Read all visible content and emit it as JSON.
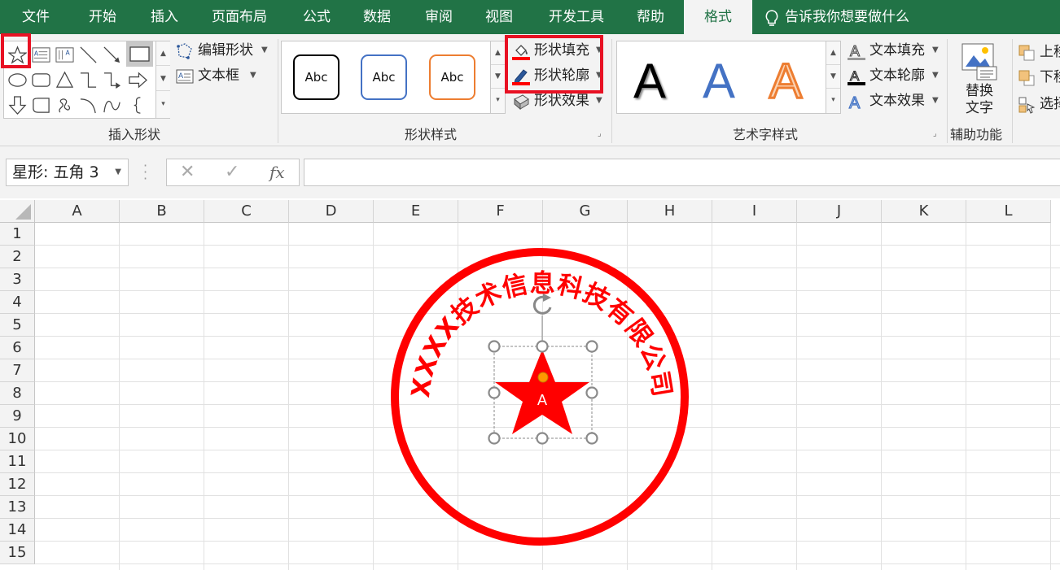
{
  "tabs": [
    {
      "label": "文件",
      "active": false
    },
    {
      "label": "开始",
      "active": false
    },
    {
      "label": "插入",
      "active": false
    },
    {
      "label": "页面布局",
      "active": false
    },
    {
      "label": "公式",
      "active": false
    },
    {
      "label": "数据",
      "active": false
    },
    {
      "label": "审阅",
      "active": false
    },
    {
      "label": "视图",
      "active": false
    },
    {
      "label": "开发工具",
      "active": false
    },
    {
      "label": "帮助",
      "active": false
    },
    {
      "label": "格式",
      "active": true
    }
  ],
  "tell_me": "告诉我你想要做什么",
  "ribbon": {
    "insert_shapes": {
      "label": "插入形状",
      "edit_shape": "编辑形状",
      "text_box": "文本框"
    },
    "shape_styles": {
      "label": "形状样式",
      "presets": [
        "Abc",
        "Abc",
        "Abc"
      ],
      "shape_fill": "形状填充",
      "shape_outline": "形状轮廓",
      "shape_effects": "形状效果"
    },
    "wordart_styles": {
      "label": "艺术字样式",
      "letters": [
        "A",
        "A",
        "A"
      ],
      "text_fill": "文本填充",
      "text_outline": "文本轮廓",
      "text_effects": "文本效果"
    },
    "accessibility": {
      "label": "辅助功能",
      "alt_text_line1": "替换",
      "alt_text_line2": "文字"
    },
    "arrange": {
      "bring_forward": "上移",
      "send_backward": "下移",
      "selection_pane": "选择"
    }
  },
  "formula_bar": {
    "name_box": "星形: 五角 3",
    "fx": "fx",
    "formula": ""
  },
  "sheet": {
    "columns": [
      "A",
      "B",
      "C",
      "D",
      "E",
      "F",
      "G",
      "H",
      "I",
      "J",
      "K",
      "L"
    ],
    "rows": [
      "1",
      "2",
      "3",
      "4",
      "5",
      "6",
      "7",
      "8",
      "9",
      "10",
      "11",
      "12",
      "13",
      "14",
      "15"
    ]
  },
  "stamp": {
    "arc_text": "XXXX技术信息科技有限公司",
    "star_text": "A",
    "color": "#ff0000"
  },
  "colors": {
    "ribbon_green": "#217346",
    "highlight_red": "#e81123",
    "fill_red": "#ff0000",
    "wordart_blue": "#4472c4",
    "wordart_orange": "#ed7d31"
  }
}
